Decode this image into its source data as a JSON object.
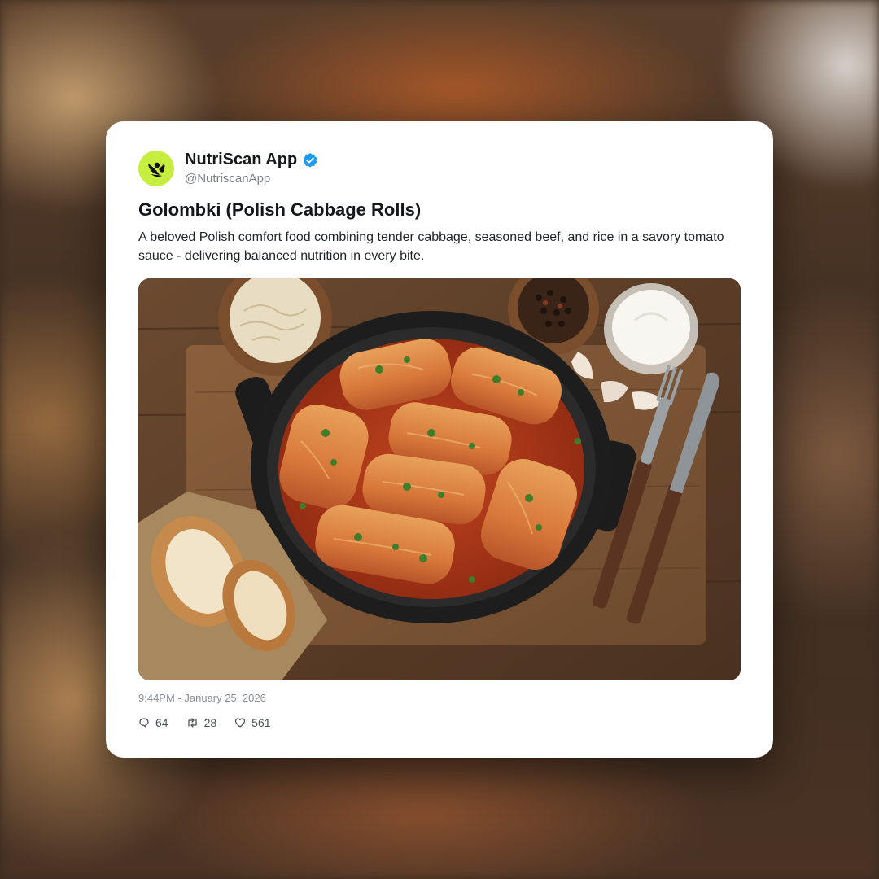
{
  "post": {
    "author": {
      "display_name": "NutriScan App",
      "handle": "@NutriscanApp",
      "verified": true,
      "avatar_icon": "leaf-scan-logo-icon",
      "avatar_color": "#c6ee3f"
    },
    "title": "Golombki (Polish Cabbage Rolls)",
    "description": "A beloved Polish comfort food combining tender cabbage, seasoned beef, and rice in a savory tomato sauce - delivering balanced nutrition in every bite.",
    "timestamp": "9:44PM - January 25, 2026",
    "stats": {
      "replies": "64",
      "reposts": "28",
      "likes": "561"
    },
    "icons": {
      "verified": "verified-badge-icon",
      "reply": "comment-bubble-icon",
      "repost": "repost-arrows-icon",
      "like": "heart-icon"
    }
  },
  "colors": {
    "verified_blue": "#1d9bf0",
    "text_primary": "#14171a",
    "text_secondary": "#7a8087"
  }
}
